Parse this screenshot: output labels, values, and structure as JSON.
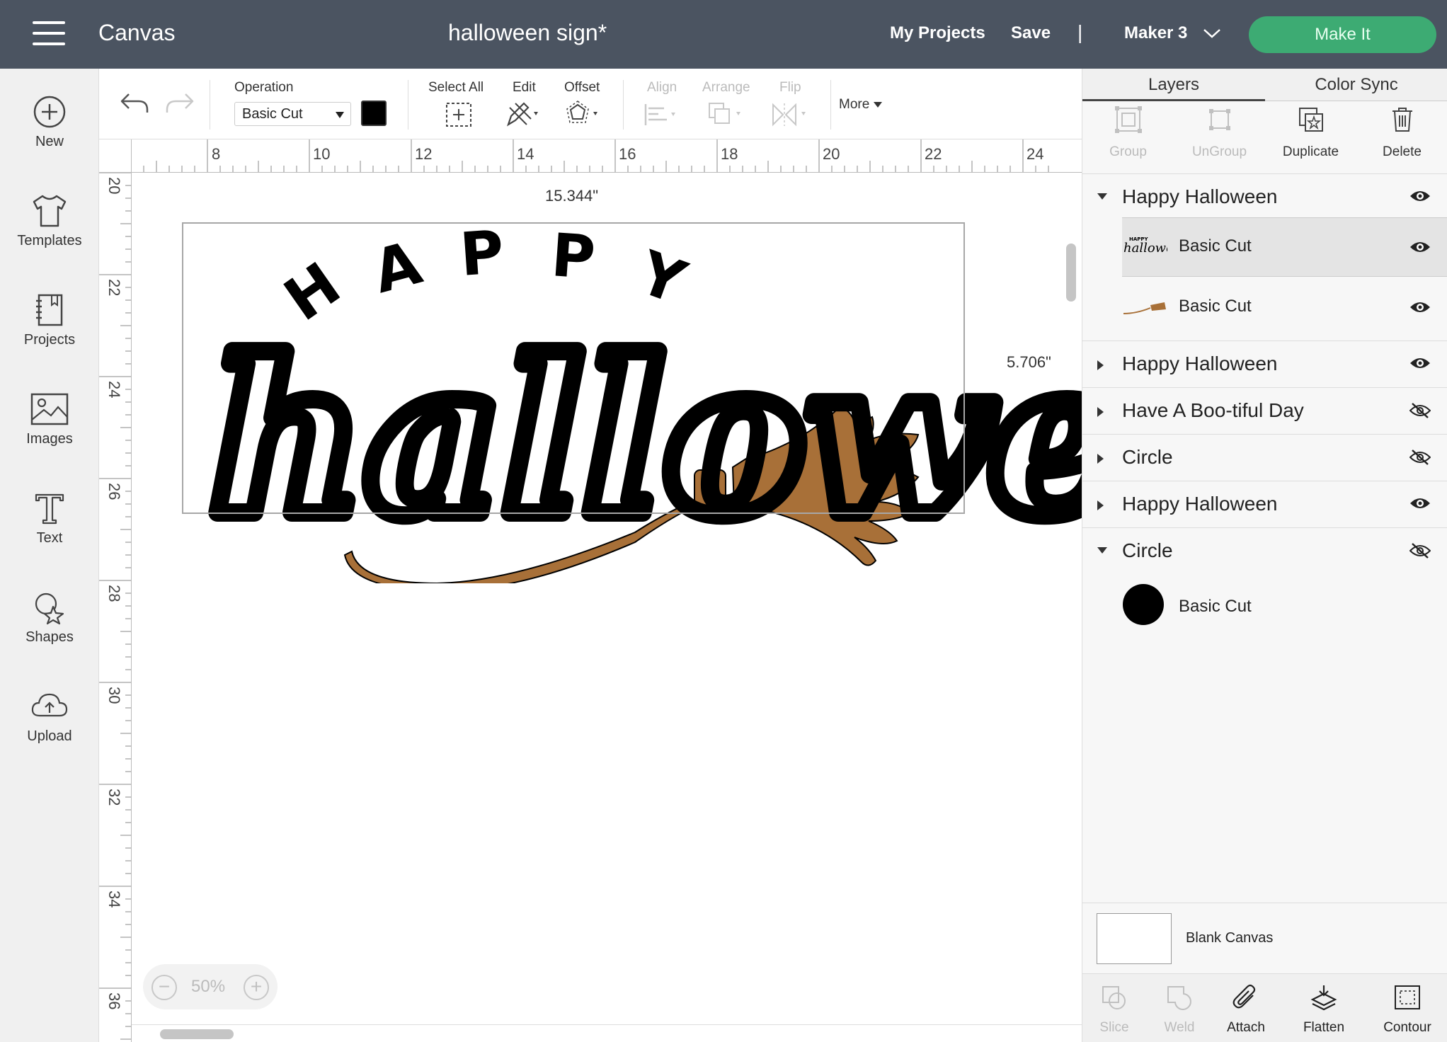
{
  "header": {
    "app_title": "Canvas",
    "project_title": "halloween sign*",
    "my_projects": "My Projects",
    "save": "Save",
    "divider": "|",
    "machine": "Maker 3",
    "make_it": "Make It"
  },
  "sidebar": {
    "items": [
      {
        "label": "New",
        "icon": "plus-circle-icon"
      },
      {
        "label": "Templates",
        "icon": "tshirt-icon"
      },
      {
        "label": "Projects",
        "icon": "notebook-icon"
      },
      {
        "label": "Images",
        "icon": "image-icon"
      },
      {
        "label": "Text",
        "icon": "text-icon"
      },
      {
        "label": "Shapes",
        "icon": "shapes-icon"
      },
      {
        "label": "Upload",
        "icon": "cloud-upload-icon"
      }
    ]
  },
  "toolbar": {
    "operation_label": "Operation",
    "operation_value": "Basic Cut",
    "operation_color": "#000000",
    "select_all": "Select All",
    "edit": "Edit",
    "offset": "Offset",
    "align": "Align",
    "arrange": "Arrange",
    "flip": "Flip",
    "more": "More"
  },
  "rulers": {
    "top": [
      "8",
      "10",
      "12",
      "14",
      "16",
      "18",
      "20",
      "22",
      "24"
    ],
    "left": [
      "20",
      "22",
      "24",
      "26",
      "28",
      "30",
      "32",
      "34",
      "36"
    ]
  },
  "canvas": {
    "width_dim": "15.344\"",
    "height_dim": "5.706\"",
    "design_text_top": "HAPPY",
    "design_text_main": "halloween",
    "broom_color": "#a87038",
    "zoom": "50%"
  },
  "layers_panel": {
    "tabs": [
      "Layers",
      "Color Sync"
    ],
    "tools": [
      "Group",
      "UnGroup",
      "Duplicate",
      "Delete"
    ],
    "groups": [
      {
        "name": "Happy Halloween",
        "expanded": true,
        "visible": true,
        "children": [
          {
            "name": "Basic Cut",
            "thumb": "halloween-text-thumb",
            "visible": true,
            "selected": true
          },
          {
            "name": "Basic Cut",
            "thumb": "broom-thumb",
            "visible": true,
            "selected": false
          }
        ]
      },
      {
        "name": "Happy Halloween",
        "expanded": false,
        "visible": true
      },
      {
        "name": "Have A Boo-tiful Day",
        "expanded": false,
        "visible": false
      },
      {
        "name": "Circle",
        "expanded": false,
        "visible": false
      },
      {
        "name": "Happy Halloween",
        "expanded": false,
        "visible": true
      },
      {
        "name": "Circle",
        "expanded": true,
        "visible": false,
        "children": [
          {
            "name": "Basic Cut",
            "thumb": "circle-thumb",
            "visible": null,
            "selected": false
          }
        ]
      }
    ],
    "blank_canvas": "Blank Canvas",
    "bottom_tools": [
      "Slice",
      "Weld",
      "Attach",
      "Flatten",
      "Contour"
    ]
  }
}
